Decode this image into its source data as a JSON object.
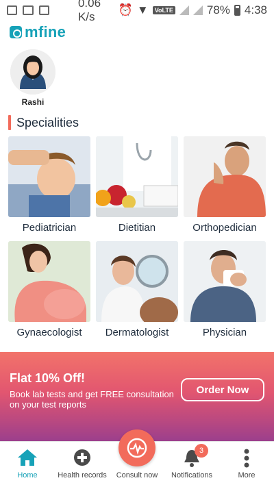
{
  "status_bar": {
    "speed": "0.06 K/s",
    "volte": "VoLTE",
    "battery": "78%",
    "time": "4:38"
  },
  "brand": {
    "name": "mfine"
  },
  "profile": {
    "name": "Rashi"
  },
  "specialities": {
    "title": "Specialities",
    "items": [
      {
        "label": "Pediatrician"
      },
      {
        "label": "Dietitian"
      },
      {
        "label": "Orthopedician"
      },
      {
        "label": "Gynaecologist"
      },
      {
        "label": "Dermatologist"
      },
      {
        "label": "Physician"
      }
    ]
  },
  "promo": {
    "title": "Flat 10% Off!",
    "subtitle": "Book lab tests and get FREE consultation on your test reports",
    "button": "Order Now"
  },
  "bottom_nav": {
    "items": [
      {
        "label": "Home",
        "icon": "home-icon"
      },
      {
        "label": "Health records",
        "icon": "plus-circle-icon"
      },
      {
        "label": "Consult now",
        "icon": "heartbeat-icon"
      },
      {
        "label": "Notifications",
        "icon": "bell-icon",
        "badge": "3"
      },
      {
        "label": "More",
        "icon": "more-vertical-icon"
      }
    ]
  },
  "colors": {
    "brand": "#17a2b8",
    "accent": "#f26b5b"
  }
}
